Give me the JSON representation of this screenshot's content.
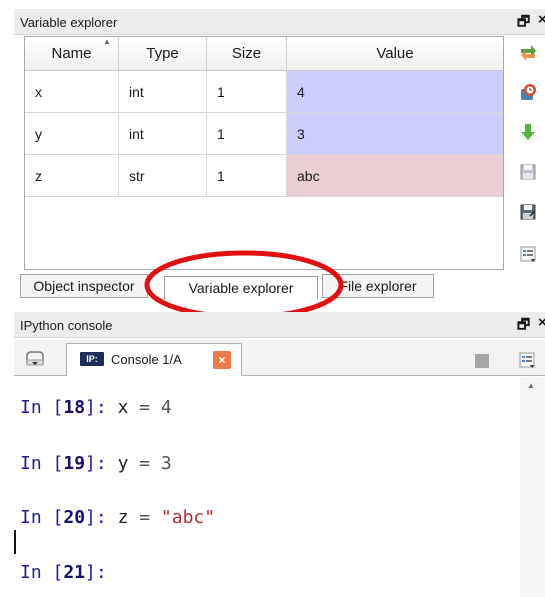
{
  "variable_explorer": {
    "title": "Variable explorer",
    "columns": [
      "Name",
      "Type",
      "Size",
      "Value"
    ],
    "rows": [
      {
        "name": "x",
        "type": "int",
        "size": "1",
        "value": "4"
      },
      {
        "name": "y",
        "type": "int",
        "size": "1",
        "value": "3"
      },
      {
        "name": "z",
        "type": "str",
        "size": "1",
        "value": "abc"
      }
    ],
    "colors": {
      "numeric_value_bg": "#cdcdfb",
      "string_value_bg": "#e9cfd3"
    }
  },
  "pane_controls": {
    "undock": "🗗",
    "close": "×"
  },
  "bottom_tabs": {
    "object_inspector": "Object inspector",
    "variable_explorer": "Variable explorer",
    "file_explorer": "File explorer"
  },
  "ipython_console": {
    "title": "IPython console",
    "tab_badge": "IP:",
    "tab_label": "Console 1/A",
    "tab_close": "×",
    "lines": [
      {
        "prompt": "In [",
        "num": "18",
        "end": "]: ",
        "code_name": "x",
        "code_op": " = ",
        "code_val": "4"
      },
      {
        "prompt": "In [",
        "num": "19",
        "end": "]: ",
        "code_name": "y",
        "code_op": " = ",
        "code_val": "3"
      },
      {
        "prompt": "In [",
        "num": "20",
        "end": "]: ",
        "code_name": "z",
        "code_op": " = ",
        "code_val": "\"abc\""
      },
      {
        "prompt": "In [",
        "num": "21",
        "end": "]:"
      }
    ]
  },
  "annotation": {
    "highlight_color": "#e01010"
  }
}
